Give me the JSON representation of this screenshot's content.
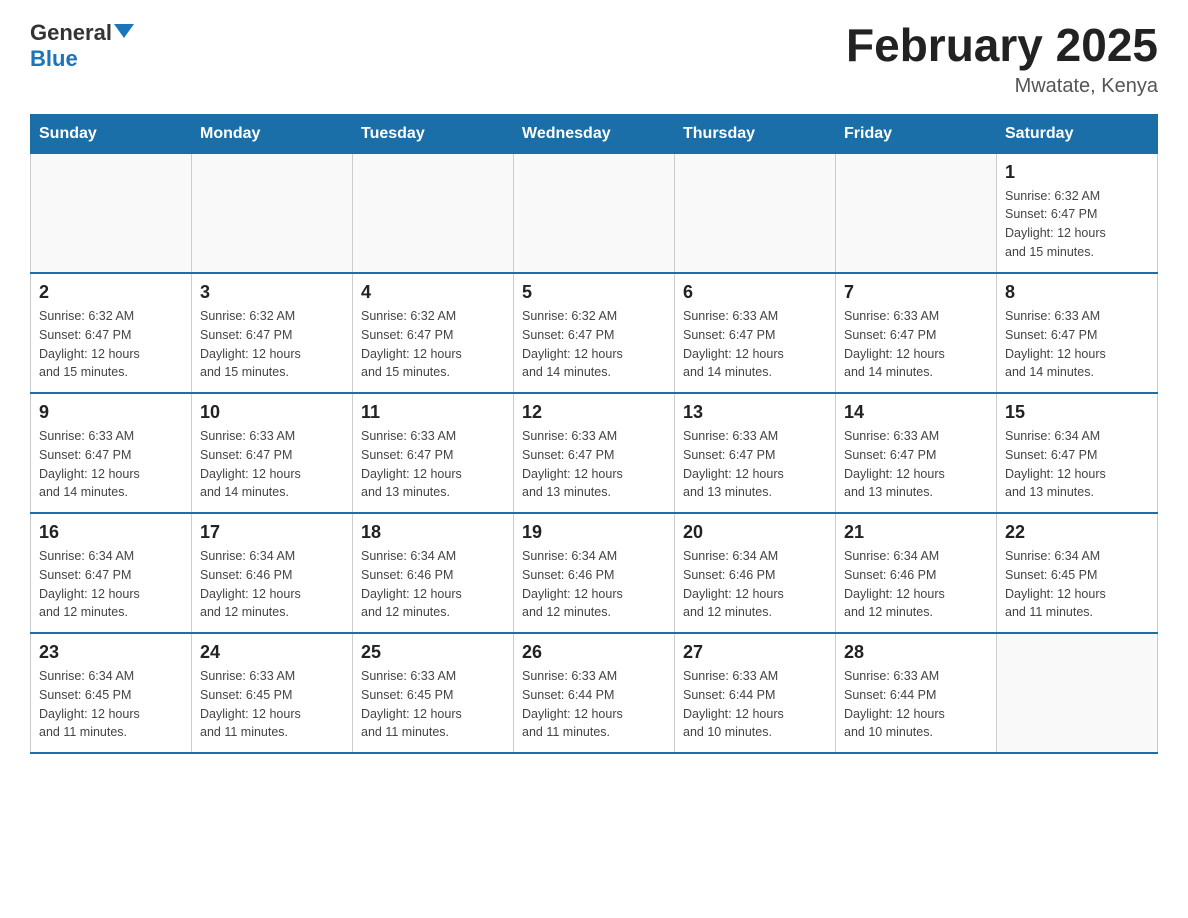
{
  "header": {
    "logo_general": "General",
    "logo_blue": "Blue",
    "month_title": "February 2025",
    "location": "Mwatate, Kenya"
  },
  "weekdays": [
    "Sunday",
    "Monday",
    "Tuesday",
    "Wednesday",
    "Thursday",
    "Friday",
    "Saturday"
  ],
  "weeks": [
    [
      {
        "day": "",
        "info": ""
      },
      {
        "day": "",
        "info": ""
      },
      {
        "day": "",
        "info": ""
      },
      {
        "day": "",
        "info": ""
      },
      {
        "day": "",
        "info": ""
      },
      {
        "day": "",
        "info": ""
      },
      {
        "day": "1",
        "info": "Sunrise: 6:32 AM\nSunset: 6:47 PM\nDaylight: 12 hours\nand 15 minutes."
      }
    ],
    [
      {
        "day": "2",
        "info": "Sunrise: 6:32 AM\nSunset: 6:47 PM\nDaylight: 12 hours\nand 15 minutes."
      },
      {
        "day": "3",
        "info": "Sunrise: 6:32 AM\nSunset: 6:47 PM\nDaylight: 12 hours\nand 15 minutes."
      },
      {
        "day": "4",
        "info": "Sunrise: 6:32 AM\nSunset: 6:47 PM\nDaylight: 12 hours\nand 15 minutes."
      },
      {
        "day": "5",
        "info": "Sunrise: 6:32 AM\nSunset: 6:47 PM\nDaylight: 12 hours\nand 14 minutes."
      },
      {
        "day": "6",
        "info": "Sunrise: 6:33 AM\nSunset: 6:47 PM\nDaylight: 12 hours\nand 14 minutes."
      },
      {
        "day": "7",
        "info": "Sunrise: 6:33 AM\nSunset: 6:47 PM\nDaylight: 12 hours\nand 14 minutes."
      },
      {
        "day": "8",
        "info": "Sunrise: 6:33 AM\nSunset: 6:47 PM\nDaylight: 12 hours\nand 14 minutes."
      }
    ],
    [
      {
        "day": "9",
        "info": "Sunrise: 6:33 AM\nSunset: 6:47 PM\nDaylight: 12 hours\nand 14 minutes."
      },
      {
        "day": "10",
        "info": "Sunrise: 6:33 AM\nSunset: 6:47 PM\nDaylight: 12 hours\nand 14 minutes."
      },
      {
        "day": "11",
        "info": "Sunrise: 6:33 AM\nSunset: 6:47 PM\nDaylight: 12 hours\nand 13 minutes."
      },
      {
        "day": "12",
        "info": "Sunrise: 6:33 AM\nSunset: 6:47 PM\nDaylight: 12 hours\nand 13 minutes."
      },
      {
        "day": "13",
        "info": "Sunrise: 6:33 AM\nSunset: 6:47 PM\nDaylight: 12 hours\nand 13 minutes."
      },
      {
        "day": "14",
        "info": "Sunrise: 6:33 AM\nSunset: 6:47 PM\nDaylight: 12 hours\nand 13 minutes."
      },
      {
        "day": "15",
        "info": "Sunrise: 6:34 AM\nSunset: 6:47 PM\nDaylight: 12 hours\nand 13 minutes."
      }
    ],
    [
      {
        "day": "16",
        "info": "Sunrise: 6:34 AM\nSunset: 6:47 PM\nDaylight: 12 hours\nand 12 minutes."
      },
      {
        "day": "17",
        "info": "Sunrise: 6:34 AM\nSunset: 6:46 PM\nDaylight: 12 hours\nand 12 minutes."
      },
      {
        "day": "18",
        "info": "Sunrise: 6:34 AM\nSunset: 6:46 PM\nDaylight: 12 hours\nand 12 minutes."
      },
      {
        "day": "19",
        "info": "Sunrise: 6:34 AM\nSunset: 6:46 PM\nDaylight: 12 hours\nand 12 minutes."
      },
      {
        "day": "20",
        "info": "Sunrise: 6:34 AM\nSunset: 6:46 PM\nDaylight: 12 hours\nand 12 minutes."
      },
      {
        "day": "21",
        "info": "Sunrise: 6:34 AM\nSunset: 6:46 PM\nDaylight: 12 hours\nand 12 minutes."
      },
      {
        "day": "22",
        "info": "Sunrise: 6:34 AM\nSunset: 6:45 PM\nDaylight: 12 hours\nand 11 minutes."
      }
    ],
    [
      {
        "day": "23",
        "info": "Sunrise: 6:34 AM\nSunset: 6:45 PM\nDaylight: 12 hours\nand 11 minutes."
      },
      {
        "day": "24",
        "info": "Sunrise: 6:33 AM\nSunset: 6:45 PM\nDaylight: 12 hours\nand 11 minutes."
      },
      {
        "day": "25",
        "info": "Sunrise: 6:33 AM\nSunset: 6:45 PM\nDaylight: 12 hours\nand 11 minutes."
      },
      {
        "day": "26",
        "info": "Sunrise: 6:33 AM\nSunset: 6:44 PM\nDaylight: 12 hours\nand 11 minutes."
      },
      {
        "day": "27",
        "info": "Sunrise: 6:33 AM\nSunset: 6:44 PM\nDaylight: 12 hours\nand 10 minutes."
      },
      {
        "day": "28",
        "info": "Sunrise: 6:33 AM\nSunset: 6:44 PM\nDaylight: 12 hours\nand 10 minutes."
      },
      {
        "day": "",
        "info": ""
      }
    ]
  ]
}
